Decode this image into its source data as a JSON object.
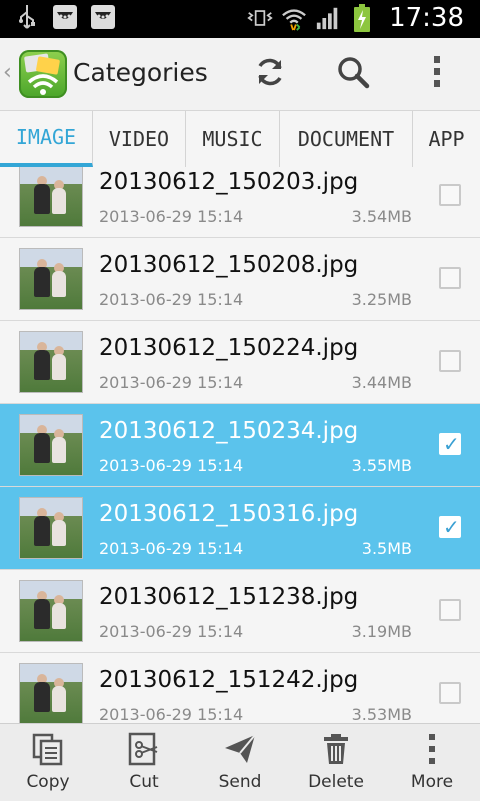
{
  "status_bar": {
    "time": "17:38"
  },
  "action_bar": {
    "title": "Categories"
  },
  "tabs": [
    {
      "label": "IMAGE",
      "active": true
    },
    {
      "label": "VIDEO",
      "active": false
    },
    {
      "label": "MUSIC",
      "active": false
    },
    {
      "label": "DOCUMENT",
      "active": false
    },
    {
      "label": "APP",
      "active": false
    }
  ],
  "files": [
    {
      "name": "20130612_150203.jpg",
      "date": "2013-06-29 15:14",
      "size": "3.54MB",
      "selected": false
    },
    {
      "name": "20130612_150208.jpg",
      "date": "2013-06-29 15:14",
      "size": "3.25MB",
      "selected": false
    },
    {
      "name": "20130612_150224.jpg",
      "date": "2013-06-29 15:14",
      "size": "3.44MB",
      "selected": false
    },
    {
      "name": "20130612_150234.jpg",
      "date": "2013-06-29 15:14",
      "size": "3.55MB",
      "selected": true
    },
    {
      "name": "20130612_150316.jpg",
      "date": "2013-06-29 15:14",
      "size": "3.5MB",
      "selected": true
    },
    {
      "name": "20130612_151238.jpg",
      "date": "2013-06-29 15:14",
      "size": "3.19MB",
      "selected": false
    },
    {
      "name": "20130612_151242.jpg",
      "date": "2013-06-29 15:14",
      "size": "3.53MB",
      "selected": false
    }
  ],
  "toolbar": {
    "copy_label": "Copy",
    "cut_label": "Cut",
    "send_label": "Send",
    "delete_label": "Delete",
    "more_label": "More"
  },
  "icons": {
    "usb": "usb-icon",
    "shopping1": "shopping-bag-icon",
    "shopping2": "shopping-bag-icon",
    "vibrate": "vibrate-icon",
    "wifi": "wifi-icon",
    "signal": "signal-icon",
    "battery": "battery-charging-icon",
    "refresh": "refresh-icon",
    "search": "search-icon",
    "overflow": "overflow-menu-icon",
    "copy": "copy-icon",
    "cut": "cut-icon",
    "send": "send-icon",
    "delete": "trash-icon",
    "more": "more-icon"
  },
  "colors": {
    "accent": "#33a6d6",
    "selected_row": "#5bc3ec",
    "statusbar": "#000000"
  }
}
